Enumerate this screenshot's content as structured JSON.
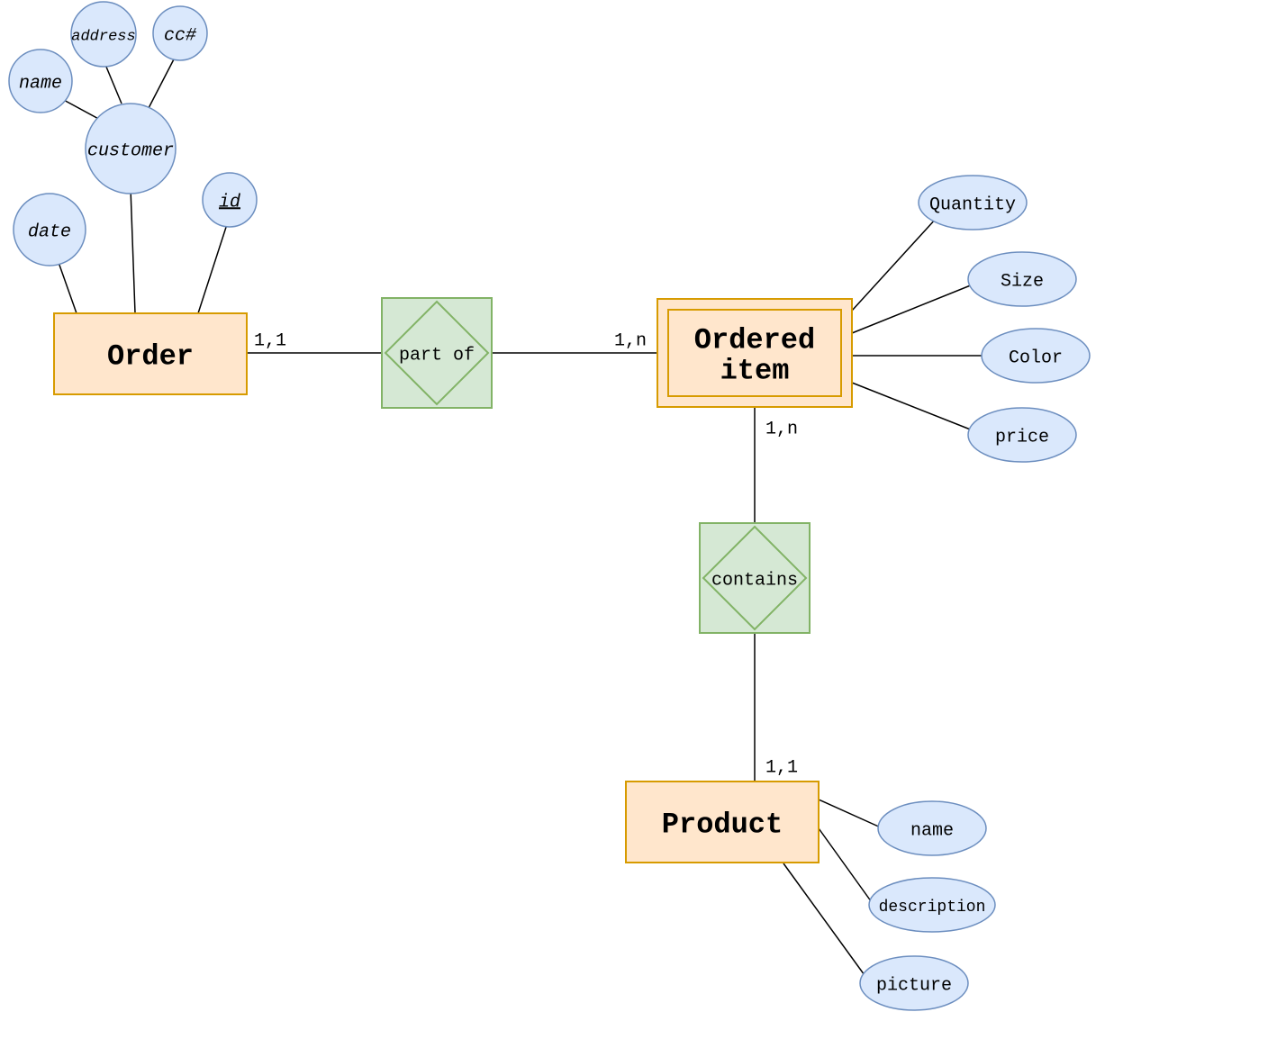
{
  "entities": {
    "order": "Order",
    "ordered_item_l1": "Ordered",
    "ordered_item_l2": "item",
    "product": "Product"
  },
  "relationships": {
    "part_of": "part of",
    "contains": "contains"
  },
  "attributes": {
    "name": "name",
    "address": "address",
    "cc": "cc#",
    "customer": "customer",
    "date": "date",
    "id": "id",
    "quantity": "Quantity",
    "size": "Size",
    "color": "Color",
    "price": "price",
    "p_name": "name",
    "p_description": "description",
    "p_picture": "picture"
  },
  "cardinalities": {
    "order_partof": "1,1",
    "partof_ordered": "1,n",
    "ordered_contains": "1,n",
    "contains_product": "1,1"
  }
}
